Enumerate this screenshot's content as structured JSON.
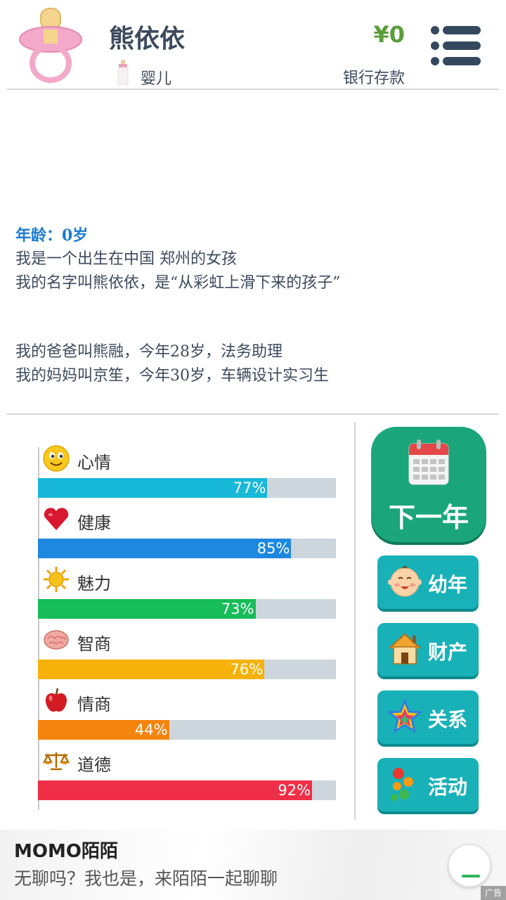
{
  "header": {
    "name": "熊依依",
    "stage": "婴儿",
    "money": "¥0",
    "bank_label": "银行存款"
  },
  "story": {
    "age_line": "年龄：0岁",
    "lines": [
      "我是一个出生在中国 郑州的女孩",
      "我的名字叫熊依依，是“从彩虹上滑下来的孩子”"
    ],
    "parents": [
      "我的爸爸叫熊融，今年28岁，法务助理",
      "我的妈妈叫京笙，今年30岁，车辆设计实习生"
    ]
  },
  "stats": [
    {
      "label": "心情",
      "value": 77,
      "pct": "77%",
      "color": "#17b8d8",
      "icon": "smiley-icon"
    },
    {
      "label": "健康",
      "value": 85,
      "pct": "85%",
      "color": "#1e88e0",
      "icon": "heart-icon"
    },
    {
      "label": "魅力",
      "value": 73,
      "pct": "73%",
      "color": "#16bd58",
      "icon": "sun-icon"
    },
    {
      "label": "智商",
      "value": 76,
      "pct": "76%",
      "color": "#f6b20b",
      "icon": "brain-icon"
    },
    {
      "label": "情商",
      "value": 44,
      "pct": "44%",
      "color": "#f5840e",
      "icon": "apple-icon"
    },
    {
      "label": "道德",
      "value": 92,
      "pct": "92%",
      "color": "#ef2f47",
      "icon": "scales-icon"
    }
  ],
  "actions": {
    "next_year": "下一年",
    "childhood": "幼年",
    "property": "财产",
    "relations": "关系",
    "activities": "活动"
  },
  "ad": {
    "title": "MOMO陌陌",
    "subtitle": "无聊吗？我也是，来陌陌一起聊聊",
    "tag": "广告"
  }
}
